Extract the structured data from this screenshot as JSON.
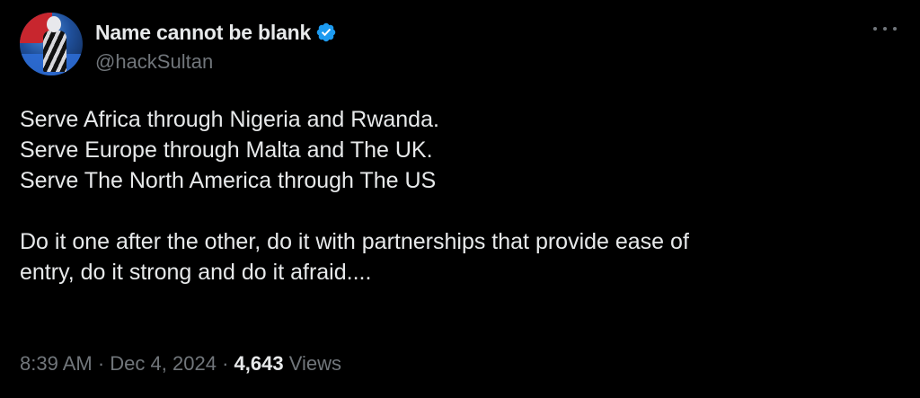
{
  "author": {
    "display_name": "Name cannot be blank",
    "handle": "@hackSultan",
    "verified": true
  },
  "icons": {
    "verified": "verified-badge-icon",
    "more": "more-horizontal-icon"
  },
  "colors": {
    "background": "#000000",
    "text_primary": "#e7e9ea",
    "text_secondary": "#71767b",
    "verified_blue": "#1d9bf0"
  },
  "tweet": {
    "lines": [
      "Serve Africa through Nigeria and Rwanda.",
      "Serve Europe through Malta and The UK.",
      "Serve The North America through The US",
      "",
      "Do it one after the other, do it with partnerships that provide ease of",
      "entry, do it strong and do it afraid...."
    ]
  },
  "meta": {
    "time": "8:39 AM",
    "separator": "·",
    "date": "Dec 4, 2024",
    "views_count": "4,643",
    "views_label": "Views"
  }
}
